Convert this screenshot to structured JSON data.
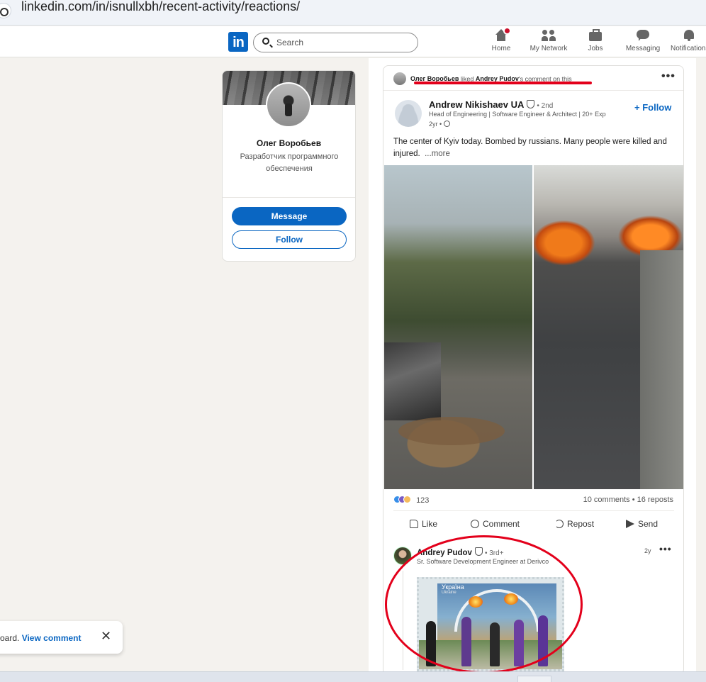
{
  "browser": {
    "url": "linkedin.com/in/isnullxbh/recent-activity/reactions/"
  },
  "nav": {
    "logo": "in",
    "search_placeholder": "Search",
    "items": [
      {
        "label": "Home",
        "icon": "home-icon"
      },
      {
        "label": "My Network",
        "icon": "people-icon"
      },
      {
        "label": "Jobs",
        "icon": "briefcase-icon"
      },
      {
        "label": "Messaging",
        "icon": "chat-icon"
      },
      {
        "label": "Notifications",
        "icon": "bell-icon"
      }
    ]
  },
  "profile": {
    "name": "Олег Воробьев",
    "headline": "Разработчик программного обеспечения",
    "message_label": "Message",
    "follow_label": "Follow"
  },
  "post": {
    "liked_actor": "Олег Воробьев",
    "liked_middle": " liked ",
    "liked_target": "Andrey Pudov",
    "liked_suffix": "'s comment on this",
    "more_label": "•••",
    "author": {
      "name": "Andrew Nikishaev UA",
      "degree": "• 2nd",
      "headline": "Head of Engineering | Software Engineer & Architect | 20+ Exp",
      "time": "2yr •",
      "follow_label": "+ Follow"
    },
    "text": "The center of Kyiv today. Bombed by russians. Many people were killed and injured.",
    "see_more": "...more",
    "reactions_count": "123",
    "stats": "10 comments • 16 reposts",
    "actions": {
      "like": "Like",
      "comment": "Comment",
      "repost": "Repost",
      "send": "Send"
    },
    "comment": {
      "name": "Andrey Pudov",
      "degree": "• 3rd+",
      "headline": "Sr. Software Development Engineer at Derivco",
      "time": "2y",
      "stamp_caption": "Україна",
      "stamp_caption_small": "Ukraine"
    }
  },
  "toast": {
    "prefix": "oard. ",
    "link": "View comment",
    "close": "✕"
  },
  "colors": {
    "brand": "#0a66c2",
    "annotation": "#e3001b"
  }
}
